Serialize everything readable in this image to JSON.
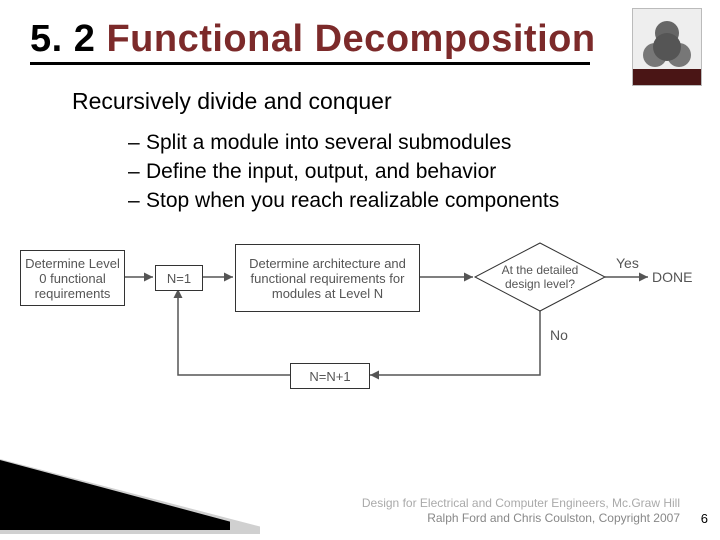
{
  "title": {
    "prefix": "5. 2 ",
    "main": "Functional Decomposition"
  },
  "subhead": "Recursively divide and conquer",
  "bullets": [
    "Split a module into several submodules",
    "Define the input, output, and behavior",
    "Stop when you reach realizable components"
  ],
  "flow": {
    "box_reqs": "Determine Level 0 functional requirements",
    "box_n1": "N=1",
    "box_arch": "Determine architecture and functional requirements for modules at Level N",
    "decision": "At the detailed design level?",
    "yes": "Yes",
    "no": "No",
    "box_inc": "N=N+1",
    "done": "DONE"
  },
  "footer": {
    "line1": "Design for Electrical and Computer Engineers, Mc.Graw Hill",
    "line2": "Ralph Ford and Chris Coulston, Copyright 2007"
  },
  "page_number": "6"
}
